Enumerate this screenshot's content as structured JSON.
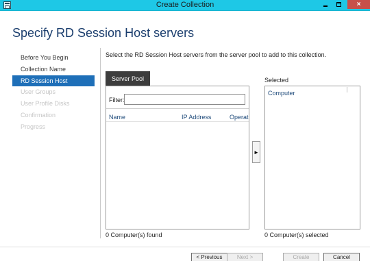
{
  "window": {
    "title": "Create Collection",
    "icon": "app-window-icon",
    "controls": {
      "minimize": "minimize-icon",
      "maximize": "maximize-icon",
      "close": "×"
    }
  },
  "page": {
    "title": "Specify RD Session Host servers"
  },
  "nav": {
    "items": [
      {
        "label": "Before You Begin",
        "state": "normal"
      },
      {
        "label": "Collection Name",
        "state": "normal"
      },
      {
        "label": "RD Session Host",
        "state": "active"
      },
      {
        "label": "User Groups",
        "state": "disabled"
      },
      {
        "label": "User Profile Disks",
        "state": "disabled"
      },
      {
        "label": "Confirmation",
        "state": "disabled"
      },
      {
        "label": "Progress",
        "state": "disabled"
      }
    ]
  },
  "main": {
    "instruction": "Select the RD Session Host servers from the server pool to add to this collection.",
    "pool": {
      "tab_label": "Server Pool",
      "filter_label": "Filter:",
      "filter_value": "",
      "columns": [
        "Name",
        "IP Address",
        "Operat"
      ],
      "rows": [],
      "count_text": "0 Computer(s) found"
    },
    "add_button": "►",
    "selected": {
      "label": "Selected",
      "column": "Computer",
      "rows": [],
      "count_text": "0 Computer(s) selected"
    }
  },
  "footer": {
    "previous": "< Previous",
    "next": "Next >",
    "create": "Create",
    "cancel": "Cancel"
  },
  "colors": {
    "titlebar": "#1ec8e6",
    "close_button": "#c7504a",
    "active_nav": "#1e6fb8",
    "page_title": "#1a3d6d",
    "tab_background": "#3d3d3d"
  }
}
